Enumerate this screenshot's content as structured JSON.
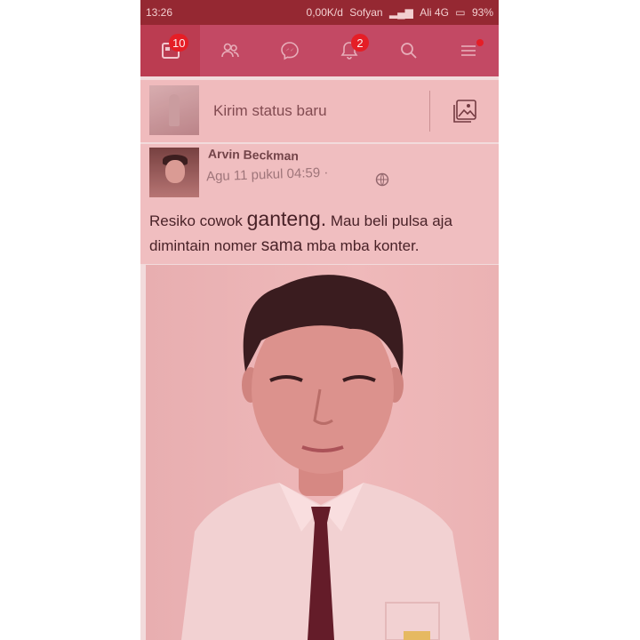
{
  "status_bar": {
    "time": "13:26",
    "network_speed": "0,00K/d",
    "carrier1": "Sofyan",
    "carrier2": "Ali 4G",
    "battery": "93%"
  },
  "nav": {
    "tabs": [
      {
        "name": "news-feed",
        "badge": "10"
      },
      {
        "name": "friend-requests",
        "badge": ""
      },
      {
        "name": "messenger",
        "badge": ""
      },
      {
        "name": "notifications",
        "badge": "2"
      },
      {
        "name": "search",
        "badge": ""
      },
      {
        "name": "menu",
        "badge": ""
      }
    ]
  },
  "composer": {
    "prompt": "Kirim status baru"
  },
  "post": {
    "author": "Arvin Beckman",
    "timestamp": "Agu 11 pukul 04:59",
    "separator": "·",
    "text_parts": [
      "Resiko cowok",
      "ganteng.",
      "Mau beli pulsa aja",
      "dimintain nomer",
      "sama",
      "mba mba konter."
    ]
  },
  "colors": {
    "navbar": "#c04a66",
    "statusbar": "#8f2630",
    "badge": "#e51c23"
  }
}
